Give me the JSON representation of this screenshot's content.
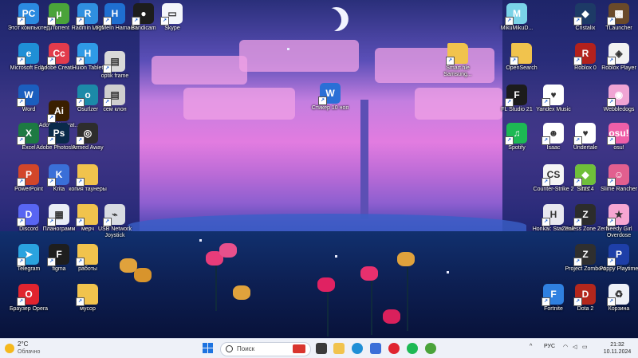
{
  "desktop": {
    "icons": [
      {
        "label": "Этот компьютер",
        "icon": "this-pc-icon",
        "color": "#2b8ae0",
        "g": "PC"
      },
      {
        "label": "Microsoft Edge",
        "icon": "edge-icon",
        "color": "#1f8fd6",
        "g": "e"
      },
      {
        "label": "Word",
        "icon": "word-icon",
        "color": "#1b5ebe",
        "g": "W"
      },
      {
        "label": "Excel",
        "icon": "excel-icon",
        "color": "#1d7a43",
        "g": "X"
      },
      {
        "label": "PowerPoint",
        "icon": "powerpoint-icon",
        "color": "#d2462a",
        "g": "P"
      },
      {
        "label": "Discord",
        "icon": "discord-icon",
        "color": "#5865f2",
        "g": "D"
      },
      {
        "label": "Telegram",
        "icon": "telegram-icon",
        "color": "#2aa3df",
        "g": "➤"
      },
      {
        "label": "Браузер Opera",
        "icon": "opera-icon",
        "color": "#e0242f",
        "g": "O"
      },
      {
        "label": "µTorrent",
        "icon": "utorrent-icon",
        "color": "#4aa33a",
        "g": "µ"
      },
      {
        "label": "Adobe Creati...",
        "icon": "adobe-cc-icon",
        "color": "#e23b4c",
        "g": "Cc"
      },
      {
        "label": "Adobe Illustrat...",
        "icon": "illustrator-icon",
        "color": "#3a1f00",
        "g": "Ai"
      },
      {
        "label": "Adobe Photosho...",
        "icon": "photoshop-icon",
        "color": "#0a2a4a",
        "g": "Ps"
      },
      {
        "label": "Krita",
        "icon": "krita-icon",
        "color": "#3a6fd8",
        "g": "K"
      },
      {
        "label": "Планограмм",
        "icon": "planner-icon",
        "color": "#e9edf6",
        "g": "▦"
      },
      {
        "label": "figma",
        "icon": "figma-icon",
        "color": "#1e1e1e",
        "g": "F"
      },
      {
        "label": "Radmin VPN",
        "icon": "radmin-vpn-icon",
        "color": "#2f8fe0",
        "g": "R"
      },
      {
        "label": "Huion Tablet",
        "icon": "huion-icon",
        "color": "#2f9ae6",
        "g": "H"
      },
      {
        "label": "Osu!lzer",
        "icon": "osu-lazer-icon",
        "color": "#1c8aa8",
        "g": "o"
      },
      {
        "label": "Armed Away",
        "icon": "armed-away-icon",
        "color": "#2d2d2d",
        "g": "◎"
      },
      {
        "label": "копия таунеры",
        "icon": "folder-icon",
        "color": "#f1c34d",
        "g": ""
      },
      {
        "label": "мерч",
        "icon": "folder-icon",
        "color": "#f1c34d",
        "g": ""
      },
      {
        "label": "работы",
        "icon": "folder-icon",
        "color": "#f1c34d",
        "g": ""
      },
      {
        "label": "мусор",
        "icon": "folder-icon",
        "color": "#f1c34d",
        "g": ""
      },
      {
        "label": "LogMeIn Hamachi",
        "icon": "hamachi-icon",
        "color": "#1f6fd0",
        "g": "H"
      },
      {
        "label": "optik frame",
        "icon": "image-file-icon",
        "color": "#d9d9d9",
        "g": "▤"
      },
      {
        "label": "сем клон",
        "icon": "file-icon",
        "color": "#cfcfcf",
        "g": "▤"
      },
      {
        "label": "USB Network Joystick",
        "icon": "usb-joystick-icon",
        "color": "#d8dbe2",
        "g": "⌁"
      },
      {
        "label": "Bandicam",
        "icon": "bandicam-icon",
        "color": "#1d1d1d",
        "g": "●"
      },
      {
        "label": "Skype",
        "icon": "skype-icon",
        "color": "#f4f6fb",
        "g": "▭"
      },
      {
        "label": "Стикер 10 ноя",
        "icon": "word-file-icon",
        "color": "#2a6fd6",
        "g": "W"
      },
      {
        "label": "Smart file Samsung...",
        "icon": "folder-icon",
        "color": "#f1c34d",
        "g": ""
      },
      {
        "label": "OpenSearch",
        "icon": "folder-icon",
        "color": "#f1c34d",
        "g": ""
      },
      {
        "label": "MikuMikuD...",
        "icon": "mikumikudance-icon",
        "color": "#7ad3e8",
        "g": "M"
      },
      {
        "label": "FL Studio 21",
        "icon": "fl-studio-icon",
        "color": "#1c1c1c",
        "g": "F"
      },
      {
        "label": "Spotify",
        "icon": "spotify-icon",
        "color": "#1db954",
        "g": "♫"
      },
      {
        "label": "Counter-Strike 2",
        "icon": "cs2-icon",
        "color": "#f5f5f5",
        "g": "CS"
      },
      {
        "label": "Honkai: Star Rail",
        "icon": "honkai-star-rail-icon",
        "color": "#e8e8f0",
        "g": "H"
      },
      {
        "label": "Project Zomboid",
        "icon": "project-zomboid-icon",
        "color": "#2f2f2f",
        "g": "Z"
      },
      {
        "label": "Fortnite",
        "icon": "fortnite-icon",
        "color": "#2f80e0",
        "g": "F"
      },
      {
        "label": "Cristalix",
        "icon": "cristalix-icon",
        "color": "#1d3a66",
        "g": "◆"
      },
      {
        "label": "Roblox 0",
        "icon": "roblox-icon",
        "color": "#b3211c",
        "g": "R"
      },
      {
        "label": "Yandex Music",
        "icon": "heart-icon",
        "color": "#ffffff",
        "g": "♥"
      },
      {
        "label": "Isaac",
        "icon": "isaac-icon",
        "color": "#ffffff",
        "g": "☻"
      },
      {
        "label": "ZZZ",
        "icon": "zenless-icon",
        "color": "#ffffff",
        "g": "Z"
      },
      {
        "label": "Dota 2",
        "icon": "dota2-icon",
        "color": "#b3271c",
        "g": "D"
      },
      {
        "label": "Zenless Zone Zero",
        "icon": "zenless-zone-zero-icon",
        "color": "#2c2c2c",
        "g": "Z"
      },
      {
        "label": "Sims 4",
        "icon": "sims4-icon",
        "color": "#6fbf3a",
        "g": "◆"
      },
      {
        "label": "Undertale",
        "icon": "undertale-icon",
        "color": "#ffffff",
        "g": "♥"
      },
      {
        "label": "TLauncher",
        "icon": "tlauncher-icon",
        "color": "#6a4a2a",
        "g": "▩"
      },
      {
        "label": "Roblox Player",
        "icon": "roblox-player-icon",
        "color": "#f2f2f2",
        "g": "◈"
      },
      {
        "label": "Webbledogs",
        "icon": "webbledogs-icon",
        "color": "#f0a4d4",
        "g": "◉"
      },
      {
        "label": "osu!",
        "icon": "osu-icon",
        "color": "#ef5fa8",
        "g": "osu!"
      },
      {
        "label": "Slime Rancher",
        "icon": "slime-rancher-icon",
        "color": "#e25f8f",
        "g": "☺"
      },
      {
        "label": "Needy Girl Overdose",
        "icon": "needy-girl-overdose-icon",
        "color": "#f6a6d2",
        "g": "★"
      },
      {
        "label": "Poppy Playtime",
        "icon": "poppy-playtime-icon",
        "color": "#1e3fa8",
        "g": "P"
      },
      {
        "label": "Корзина",
        "icon": "recycle-bin-icon",
        "color": "#eef1f7",
        "g": "♻"
      }
    ]
  },
  "taskbar": {
    "weather_temp": "2°C",
    "weather_cond": "Облачно",
    "search_placeholder": "Поиск",
    "lang": "РУС",
    "time": "21:32",
    "date": "10.11.2024"
  }
}
